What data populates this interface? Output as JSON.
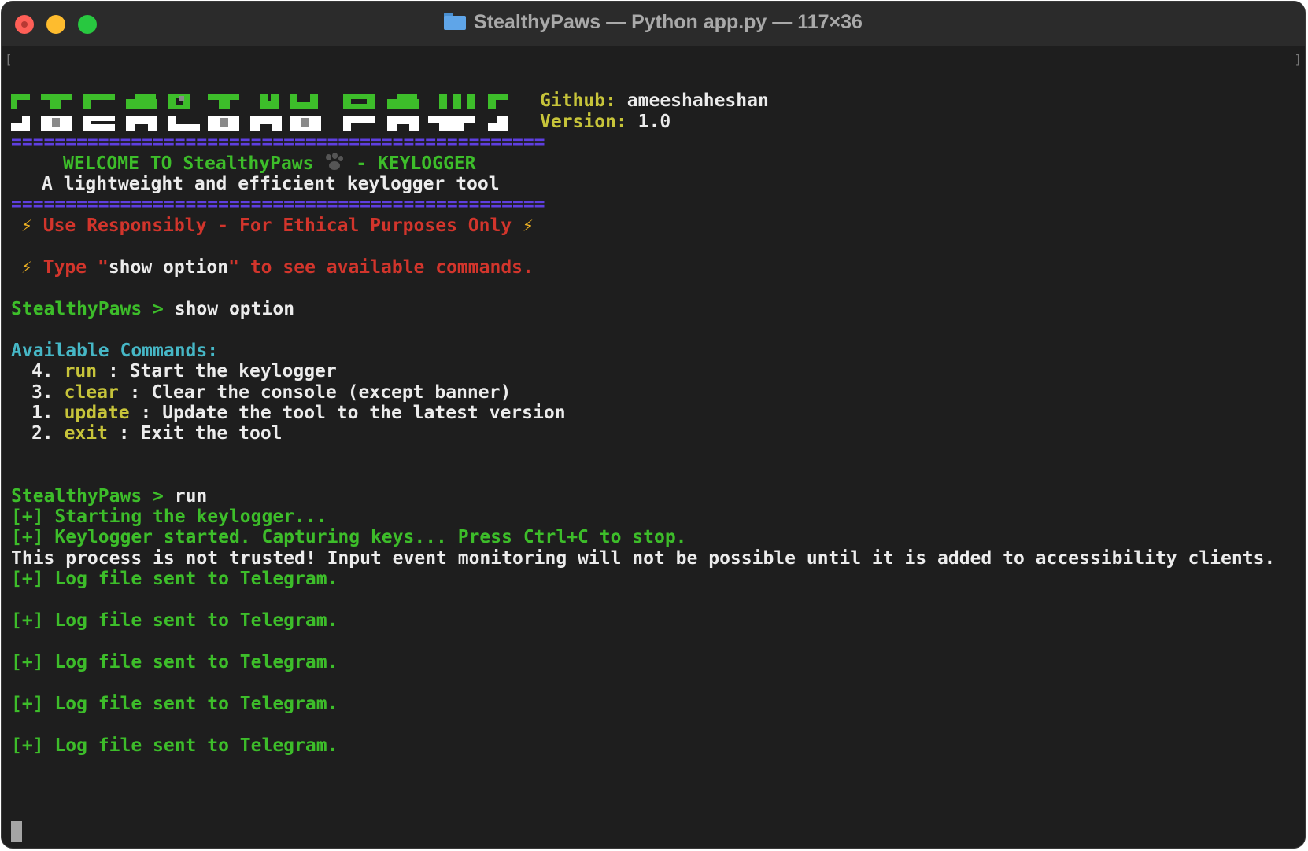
{
  "window": {
    "title": "StealthyPaws — Python app.py — 117×36"
  },
  "banner": {
    "github_label": "Github:",
    "github_value": "ameeshaheshan",
    "version_label": "Version:",
    "version_value": "1.0",
    "separator": "=================================================",
    "welcome_a": "WELCOME TO StealthyPaws ",
    "welcome_b": " - KEYLOGGER",
    "tagline": "A lightweight and efficient keylogger tool",
    "warning": "Use Responsibly - For Ethical Purposes Only",
    "hint_a": "Type \"",
    "hint_b": "show option",
    "hint_c": "\" to see available commands.",
    "bolt": "⚡"
  },
  "session": {
    "prompt": "StealthyPaws > ",
    "command1": "show option",
    "commands_heading": "Available Commands:",
    "commands": [
      {
        "num": "4.",
        "name": "run",
        "desc": " : Start the keylogger"
      },
      {
        "num": "3.",
        "name": "clear",
        "desc": " : Clear the console (except banner)"
      },
      {
        "num": "1.",
        "name": "update",
        "desc": " : Update the tool to the latest version"
      },
      {
        "num": "2.",
        "name": "exit",
        "desc": " : Exit the tool"
      }
    ],
    "command2": "run",
    "out_starting": "[+] Starting the keylogger...",
    "out_started": "[+] Keylogger started. Capturing keys... Press Ctrl+C to stop.",
    "out_untrusted": "This process is not trusted! Input event monitoring will not be possible until it is added to accessibility clients.",
    "out_logs": [
      "[+] Log file sent to Telegram.",
      "[+] Log file sent to Telegram.",
      "[+] Log file sent to Telegram.",
      "[+] Log file sent to Telegram.",
      "[+] Log file sent to Telegram."
    ]
  },
  "colors": {
    "background": "#1e1e1e",
    "green": "#3dbd2a",
    "yellow": "#c7c43a",
    "red": "#d2352c",
    "cyan": "#46b7c6",
    "separator": "#5f3fe0"
  }
}
